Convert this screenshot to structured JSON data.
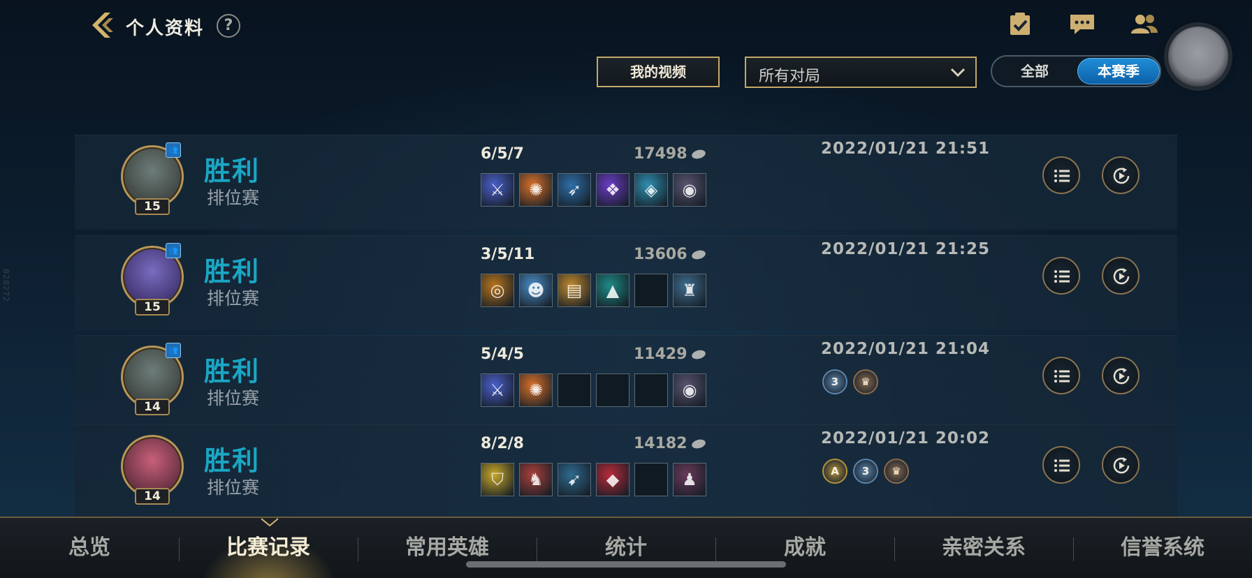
{
  "header": {
    "title": "个人资料",
    "help": "?"
  },
  "filters": {
    "video_button": "我的视频",
    "match_filter": "所有对局",
    "toggle_all": "全部",
    "toggle_season": "本赛季"
  },
  "watermark": "828272",
  "matches": [
    {
      "result": "胜利",
      "mode": "排位赛",
      "level": "15",
      "kda": "6/5/7",
      "gold": "17498",
      "date": "2022/01/21 21:51",
      "champion": "champion-tryndamere-portrait",
      "items": [
        "blade-item",
        "orb-item",
        "crossbow-item",
        "cloak-item",
        "scale-item",
        "ward-item"
      ],
      "item_colors": [
        "#4a5fc8",
        "#d8712a",
        "#2e6fa8",
        "#6b3cc6",
        "#2f8fb0",
        "#5a5470"
      ],
      "medals": []
    },
    {
      "result": "胜利",
      "mode": "排位赛",
      "level": "15",
      "kda": "3/5/11",
      "gold": "13606",
      "date": "2022/01/21 21:25",
      "champion": "champion-poppy-portrait",
      "items": [
        "eye-item",
        "mask-item",
        "tome-item",
        "hood-item",
        "empty-slot",
        "lantern-item"
      ],
      "item_colors": [
        "#b8741e",
        "#4a8cc6",
        "#c08a2e",
        "#1e8a86",
        "",
        "#3f6d8e"
      ],
      "medals": []
    },
    {
      "result": "胜利",
      "mode": "排位赛",
      "level": "14",
      "kda": "5/4/5",
      "gold": "11429",
      "date": "2022/01/21 21:04",
      "champion": "champion-tryndamere-portrait",
      "items": [
        "blade-item",
        "orb-item",
        "empty-slot",
        "empty-slot",
        "empty-slot",
        "ward-item"
      ],
      "item_colors": [
        "#4a5fc8",
        "#d8712a",
        "",
        "",
        "",
        "#5a5470"
      ],
      "medals": [
        {
          "label": "3",
          "name": "triple-kill-medal",
          "color": "#5b86b0"
        },
        {
          "label": "♛",
          "name": "crest-medal",
          "color": "#8e6a4a"
        }
      ]
    },
    {
      "result": "胜利",
      "mode": "排位赛",
      "level": "14",
      "kda": "8/2/8",
      "gold": "14182",
      "date": "2022/01/21 20:02",
      "champion": "champion-vi-portrait",
      "items": [
        "shield-item",
        "armor-item",
        "bow-item",
        "gem-item",
        "empty-slot",
        "totem-item"
      ],
      "item_colors": [
        "#c8a82a",
        "#a8403a",
        "#2f6a8e",
        "#b82a3a",
        "",
        "#6a3a5a"
      ],
      "medals": [
        {
          "label": "A",
          "name": "ace-medal",
          "color": "#b8943a"
        },
        {
          "label": "3",
          "name": "triple-kill-medal",
          "color": "#5b86b0"
        },
        {
          "label": "♛",
          "name": "crest-medal",
          "color": "#8e6a4a"
        }
      ]
    }
  ],
  "nav": {
    "tabs": [
      "总览",
      "比赛记录",
      "常用英雄",
      "统计",
      "成就",
      "亲密关系",
      "信誉系统"
    ],
    "active": "比赛记录"
  },
  "colors": {
    "accent_gold": "#c4a869",
    "result_win": "#1aa6c4",
    "toggle_active": "#1f8fd8"
  }
}
